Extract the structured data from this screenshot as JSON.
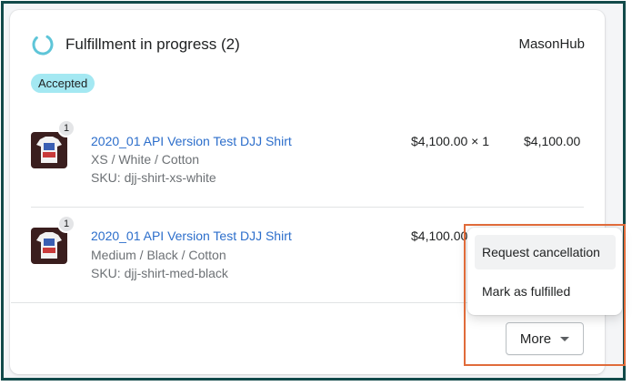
{
  "fulfillment": {
    "title": "Fulfillment in progress (2)",
    "location": "MasonHub",
    "status_badge": "Accepted",
    "status_icon": "progress-circle-icon"
  },
  "items": [
    {
      "quantity_badge": "1",
      "title": "2020_01 API Version Test DJJ Shirt",
      "variant": "XS / White / Cotton",
      "sku": "SKU: djj-shirt-xs-white",
      "unit_price": "$4,100.00 × 1",
      "total": "$4,100.00"
    },
    {
      "quantity_badge": "1",
      "title": "2020_01 API Version Test DJJ Shirt",
      "variant": "Medium / Black / Cotton",
      "sku": "SKU: djj-shirt-med-black",
      "unit_price": "$4,100.00"
    }
  ],
  "actions": {
    "more_label": "More",
    "menu": [
      "Request cancellation",
      "Mark as fulfilled"
    ]
  },
  "colors": {
    "link": "#2c6ecb",
    "badge_bg": "#a4e8f2",
    "frame": "#124a4a",
    "highlight": "#e06b3a"
  }
}
